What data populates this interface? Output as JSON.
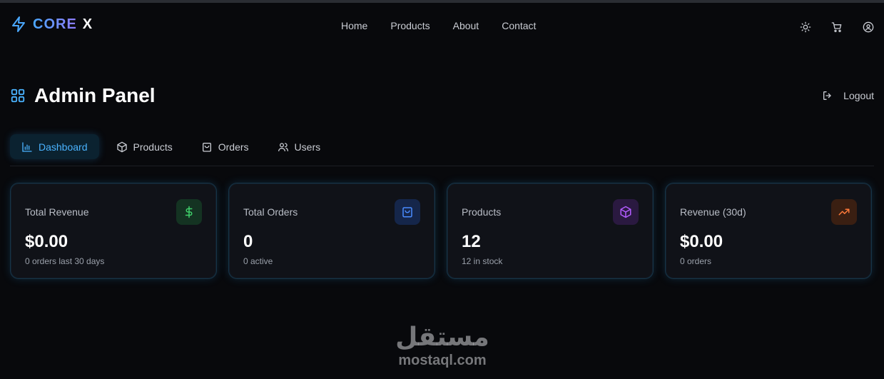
{
  "brand": {
    "word1": "CORE",
    "word2": "X",
    "icon": "lightning-bolt-icon",
    "gradient": [
      "#4aa8ff",
      "#8f7bff"
    ]
  },
  "nav": {
    "links": [
      "Home",
      "Products",
      "About",
      "Contact"
    ],
    "icons": [
      "sun-icon",
      "cart-icon",
      "user-circle-icon"
    ]
  },
  "header": {
    "title": "Admin Panel",
    "title_icon": "grid-icon",
    "logout_label": "Logout"
  },
  "tabs": [
    {
      "label": "Dashboard",
      "icon": "bar-chart-icon",
      "active": true
    },
    {
      "label": "Products",
      "icon": "box-icon",
      "active": false
    },
    {
      "label": "Orders",
      "icon": "shopping-bag-icon",
      "active": false
    },
    {
      "label": "Users",
      "icon": "users-icon",
      "active": false
    }
  ],
  "stats": [
    {
      "label": "Total Revenue",
      "value": "$0.00",
      "sub": "0 orders last 30 days",
      "icon": "dollar-icon",
      "color": "#3fcf6a"
    },
    {
      "label": "Total Orders",
      "value": "0",
      "sub": "0 active",
      "icon": "shopping-bag-icon",
      "color": "#4a8cff"
    },
    {
      "label": "Products",
      "value": "12",
      "sub": "12 in stock",
      "icon": "box-icon",
      "color": "#b35cff"
    },
    {
      "label": "Revenue (30d)",
      "value": "$0.00",
      "sub": "0 orders",
      "icon": "trending-up-icon",
      "color": "#ff7a3a"
    }
  ],
  "accent": "#4ab3ff",
  "watermark": {
    "arabic": "مستقل",
    "latin": "mostaql.com"
  }
}
